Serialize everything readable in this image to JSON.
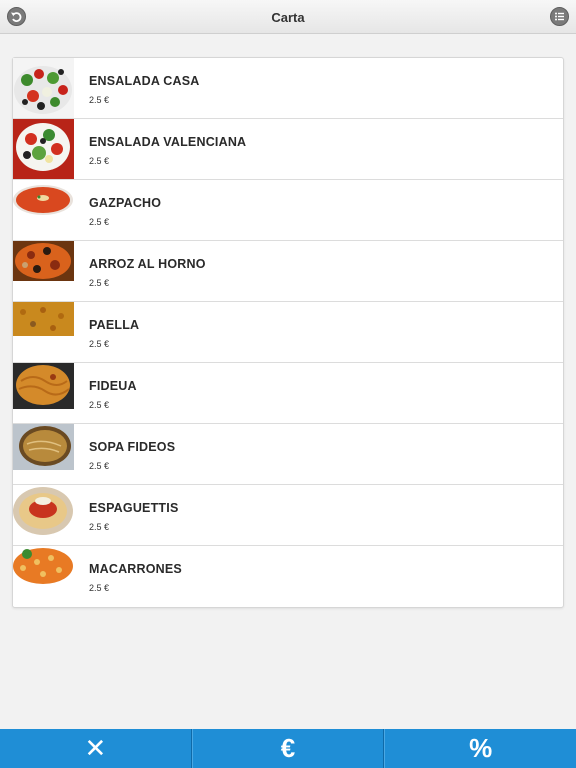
{
  "header": {
    "title": "Carta",
    "back_icon": "back-arrow-icon",
    "menu_icon": "list-menu-icon"
  },
  "menu": {
    "items": [
      {
        "name": "ENSALADA CASA",
        "price": "2.5 €",
        "image": "salad-photo"
      },
      {
        "name": "ENSALADA VALENCIANA",
        "price": "2.5 €",
        "image": "valencian-salad-photo"
      },
      {
        "name": "GAZPACHO",
        "price": "2.5 €",
        "image": "gazpacho-photo"
      },
      {
        "name": "ARROZ AL HORNO",
        "price": "2.5 €",
        "image": "baked-rice-photo"
      },
      {
        "name": "PAELLA",
        "price": "2.5 €",
        "image": "paella-photo"
      },
      {
        "name": "FIDEUA",
        "price": "2.5 €",
        "image": "fideua-photo"
      },
      {
        "name": "SOPA FIDEOS",
        "price": "2.5 €",
        "image": "noodle-soup-photo"
      },
      {
        "name": "ESPAGUETTIS",
        "price": "2.5 €",
        "image": "spaghetti-photo"
      },
      {
        "name": "MACARRONES",
        "price": "2.5 €",
        "image": "macaroni-photo"
      }
    ]
  },
  "toolbar": {
    "close_label": "✕",
    "currency_label": "€",
    "percent_label": "%",
    "accent_color": "#1f8ed6"
  }
}
